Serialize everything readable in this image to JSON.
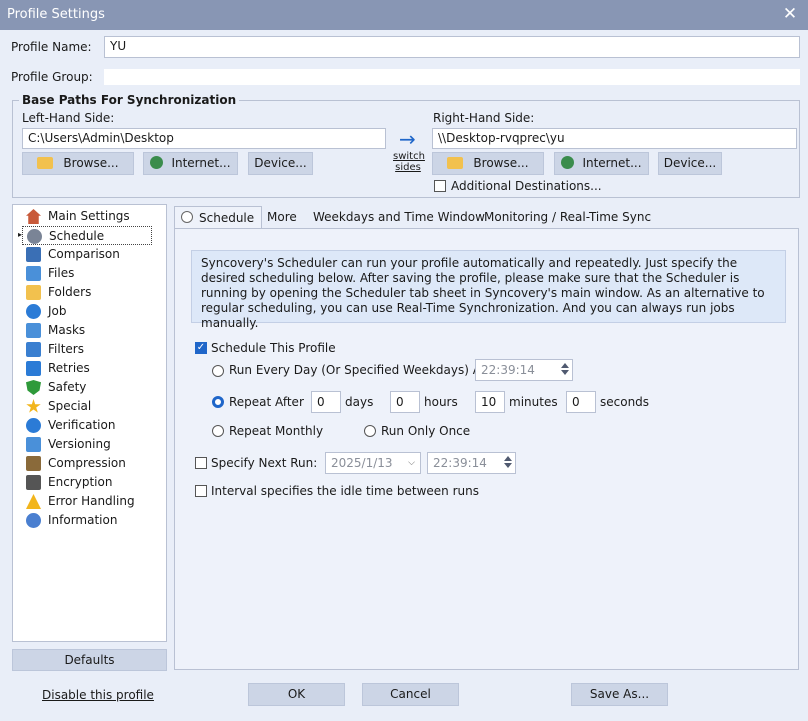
{
  "window": {
    "title": "Profile Settings"
  },
  "profile": {
    "name_label": "Profile Name:",
    "name_value": "YU",
    "group_label": "Profile Group:",
    "group_value": ""
  },
  "base_paths": {
    "title": "Base Paths For Synchronization",
    "left_label": "Left-Hand Side:",
    "left_value": "C:\\Users\\Admin\\Desktop",
    "right_label": "Right-Hand Side:",
    "right_value": "\\\\Desktop-rvqprec\\yu",
    "browse": "Browse...",
    "internet": "Internet...",
    "device": "Device...",
    "switch_line1": "switch",
    "switch_line2": "sides",
    "additional": "Additional Destinations..."
  },
  "nav": {
    "items": [
      {
        "label": "Main Settings",
        "icon": "house-icon"
      },
      {
        "label": "Schedule",
        "icon": "clock-icon"
      },
      {
        "label": "Comparison",
        "icon": "comparison-icon"
      },
      {
        "label": "Files",
        "icon": "files-icon"
      },
      {
        "label": "Folders",
        "icon": "folder-icon"
      },
      {
        "label": "Job",
        "icon": "job-icon"
      },
      {
        "label": "Masks",
        "icon": "masks-icon"
      },
      {
        "label": "Filters",
        "icon": "filters-icon"
      },
      {
        "label": "Retries",
        "icon": "retry-arrow-icon"
      },
      {
        "label": "Safety",
        "icon": "shield-icon"
      },
      {
        "label": "Special",
        "icon": "star-icon"
      },
      {
        "label": "Verification",
        "icon": "verification-check-icon"
      },
      {
        "label": "Versioning",
        "icon": "versioning-icon"
      },
      {
        "label": "Compression",
        "icon": "compression-icon"
      },
      {
        "label": "Encryption",
        "icon": "lock-icon"
      },
      {
        "label": "Error Handling",
        "icon": "warning-icon"
      },
      {
        "label": "Information",
        "icon": "info-icon"
      }
    ],
    "selected": "Schedule",
    "defaults": "Defaults"
  },
  "tabs": [
    "Schedule",
    "More",
    "Weekdays and Time Window",
    "Monitoring / Real-Time Sync"
  ],
  "schedule": {
    "info": "Syncovery's Scheduler can run your profile automatically and repeatedly. Just specify the desired scheduling below. After saving the profile, please make sure that the Scheduler is running by opening the Scheduler tab sheet in Syncovery's main window.  As an alternative to regular scheduling, you can use Real-Time Synchronization. And you can always run jobs manually.",
    "schedule_this_profile": "Schedule This Profile",
    "run_every_day": "Run Every Day (Or Specified Weekdays) At",
    "run_every_day_time": "22:39:14",
    "repeat_after": "Repeat After",
    "days_value": "0",
    "days_label": "days",
    "hours_value": "0",
    "hours_label": "hours",
    "minutes_value": "10",
    "minutes_label": "minutes",
    "seconds_value": "0",
    "seconds_label": "seconds",
    "repeat_monthly": "Repeat Monthly",
    "run_only_once": "Run Only Once",
    "specify_next_run": "Specify Next Run:",
    "next_run_date": "2025/1/13",
    "next_run_time": "22:39:14",
    "interval_idle": "Interval specifies the idle time between runs"
  },
  "footer": {
    "disable": "Disable this profile",
    "ok": "OK",
    "cancel": "Cancel",
    "save_as": "Save As..."
  },
  "colors": {
    "accent": "#1f66c9",
    "titlebar": "#8896b4",
    "background": "#e9eef8"
  }
}
